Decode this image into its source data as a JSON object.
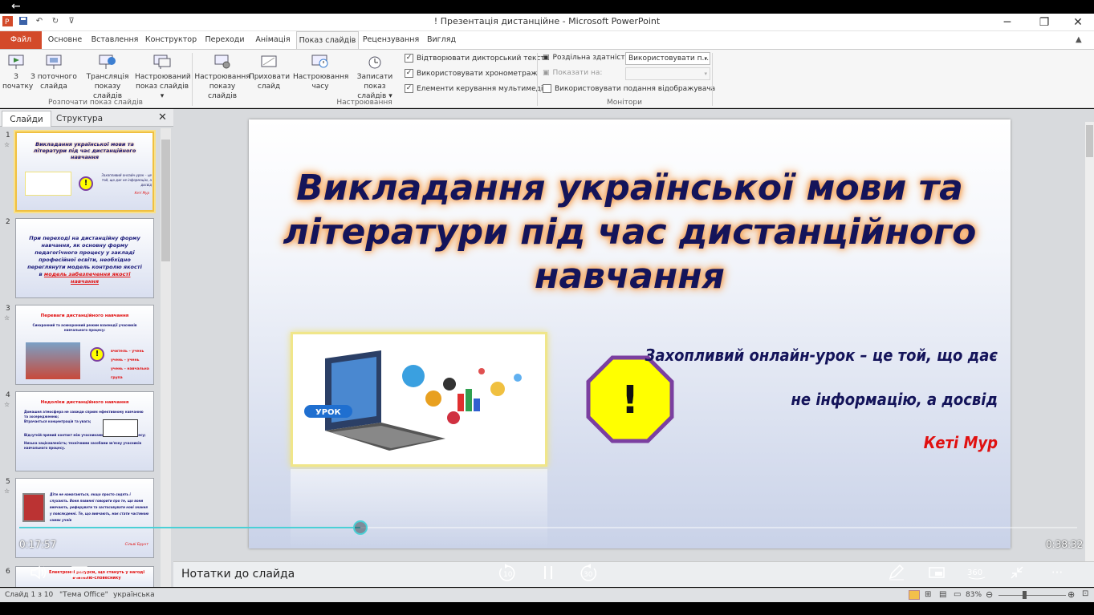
{
  "window": {
    "title": "! Презентація дистанційне  -  Microsoft PowerPoint"
  },
  "ribbon_tabs": [
    "Файл",
    "Основне",
    "Вставлення",
    "Конструктор",
    "Переходи",
    "Анімація",
    "Показ слайдів",
    "Рецензування",
    "Вигляд"
  ],
  "ribbon": {
    "btn_from_start": [
      "З",
      "початку"
    ],
    "btn_from_current": [
      "З поточного",
      "слайда"
    ],
    "btn_broadcast": [
      "Трансляція",
      "показу слайдів"
    ],
    "btn_custom": [
      "Настроюваний",
      "показ слайдів ▾"
    ],
    "group_start": "Розпочати показ слайдів",
    "btn_setup": [
      "Настроювання",
      "показу слайдів"
    ],
    "btn_hide": [
      "Приховати",
      "слайд"
    ],
    "btn_timing": [
      "Настроювання",
      "часу"
    ],
    "btn_record": [
      "Записати показ",
      "слайдів ▾"
    ],
    "chk_narration": "Відтворювати дикторський текст",
    "chk_timings": "Використовувати хронометраж",
    "chk_media": "Елементи керування мультимедіа",
    "group_setup": "Настроювання",
    "resolution_label": "Роздільна здатність:",
    "resolution_value": "Використовувати п...",
    "show_on_label": "Показати на:",
    "presenter_view": "Використовувати подання відображувача",
    "group_monitors": "Монітори"
  },
  "left_panel": {
    "tab_slides": "Слайди",
    "tab_outline": "Структура",
    "close": "✕",
    "thumbs": [
      {
        "num": "1",
        "text": "Викладання української мови та літератури під час дистанційного навчання",
        "quote": "Захопливий онлайн-урок – це той, що дає не інформацію, а досвід",
        "author": "Кеті Мур"
      },
      {
        "num": "2",
        "text": "При переході на дистанційну форму навчання, як основну форму педагогічного процесу у закладі професійної освіти, необхідно переглянути модель контролю якості в",
        "link": "модель забезпечення якості навчання"
      },
      {
        "num": "3",
        "title": "Переваги дистанційного навчання",
        "text": "Синхронний та асинхронний режим взаємодії учасників навчального процесу:",
        "l1": "вчитель – учень",
        "l2": "учень – учень",
        "l3": "учень – навчальна група"
      },
      {
        "num": "4",
        "title": "Недоліки дистанційного навчання",
        "b1": "Домашня атмосфера не завжди сприяє ефективному навчанню та зосередженню;",
        "b2": "Втрачається концентрація та увага;",
        "b3": "Відсутній прямий контакт між учасниками навчального процесу;",
        "b4": "Низька зацікавленість; технічними засобами зв'язку учасників навчального процесу."
      },
      {
        "num": "5",
        "text": "Діти не намагаються, якщо просто сидять і слухають. Вони повинні говорити про те, що вони вивчають, реферувати та застосовувати нові знання у повсякденні. Те, що вивчають, має стати частиною самих учнів",
        "author": "Сільві Брунт"
      },
      {
        "num": "6",
        "text": "Електронні ресурси, що стануть у нагоді вчителю-словеснику"
      }
    ]
  },
  "slide": {
    "title": "Викладання української мови та літератури під час дистанційного навчання",
    "image_label": "УРОК",
    "warning": "!",
    "quote_line1": "Захопливий онлайн-урок – це той, що дає",
    "quote_line2": "не інформацію, а досвід",
    "author": "Кеті Мур"
  },
  "notes_placeholder": "Нотатки до слайда",
  "status": {
    "slide": "Слайд 1 з 10",
    "theme": "\"Тема Office\"",
    "language": "українська",
    "zoom": "83%"
  },
  "video": {
    "elapsed": "0:17:57",
    "total": "0:38:32",
    "progress": 0.3225,
    "skip_back": "10",
    "skip_forward": "30",
    "more": "···"
  },
  "colors": {
    "file_tab": "#d34a2a",
    "progress": "#4ad0d6",
    "title_glow": "#f6a45a",
    "title_text": "#14145a",
    "warning_fill": "#ffff00",
    "warning_border": "#7b3fa0",
    "author": "#e01010"
  }
}
